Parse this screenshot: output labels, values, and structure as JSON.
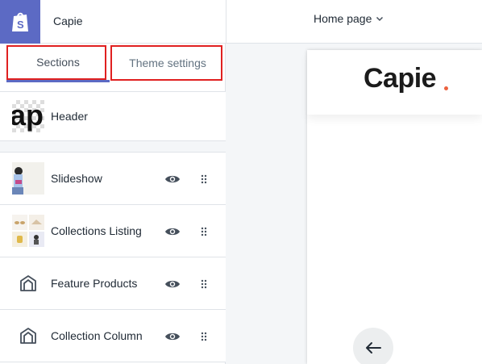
{
  "app": {
    "name": "Capie"
  },
  "header": {
    "page_select": "Home page"
  },
  "tabs": [
    {
      "label": "Sections",
      "active": true
    },
    {
      "label": "Theme settings",
      "active": false
    }
  ],
  "header_section": {
    "thumb_text": "ap",
    "label": "Header"
  },
  "sections": [
    {
      "label": "Slideshow",
      "icon": "slideshow-thumbnail"
    },
    {
      "label": "Collections Listing",
      "icon": "collections-thumbnail"
    },
    {
      "label": "Feature Products",
      "icon": "section-template-icon"
    },
    {
      "label": "Collection Column",
      "icon": "section-template-icon"
    }
  ],
  "preview": {
    "brand": "Capie",
    "brand_dot_color": "#ec6240"
  },
  "colors": {
    "accent": "#5c6ac4",
    "highlight": "#e02020"
  }
}
